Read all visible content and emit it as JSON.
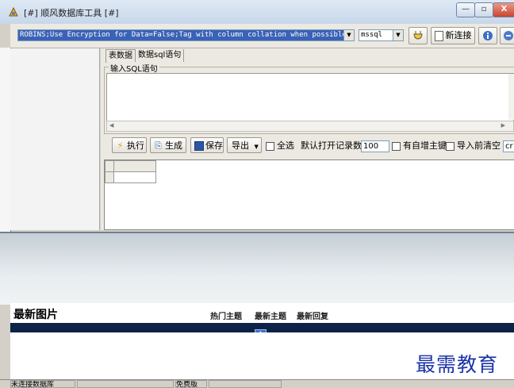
{
  "window": {
    "title": "[#] 顺风数据库工具 [#]",
    "minimize_glyph": "—",
    "maximize_glyph": "▫",
    "close_glyph": "X"
  },
  "toolbar": {
    "connection_string": "ROBINS;Use Encryption for Data=False;Tag with column collation when possible=False",
    "db_type": "mssql",
    "new_connection_label": "新连接"
  },
  "tabs": [
    {
      "label": "表数据",
      "active": true
    },
    {
      "label": "数据sql语句",
      "active": false
    }
  ],
  "sql": {
    "group_label": "输入SQL语句",
    "value": ""
  },
  "actions": {
    "execute_label": "执行",
    "generate_label": "生成",
    "save_label": "保存",
    "export_label": "导出",
    "select_all_label": "全选",
    "default_rows_label": "默认打开记录数:",
    "default_rows_value": "100",
    "has_auto_pk_label": "有自增主键",
    "clear_before_import_label": "导入前清空",
    "extra_input_value": "cr"
  },
  "news": {
    "title": "最新图片",
    "tabs": [
      "热门主题",
      "最新主题",
      "最新回复"
    ],
    "nav_glyph": "A"
  },
  "status": {
    "connection": "未连接数据库",
    "edition": "免费版"
  },
  "watermark": "最需教育"
}
